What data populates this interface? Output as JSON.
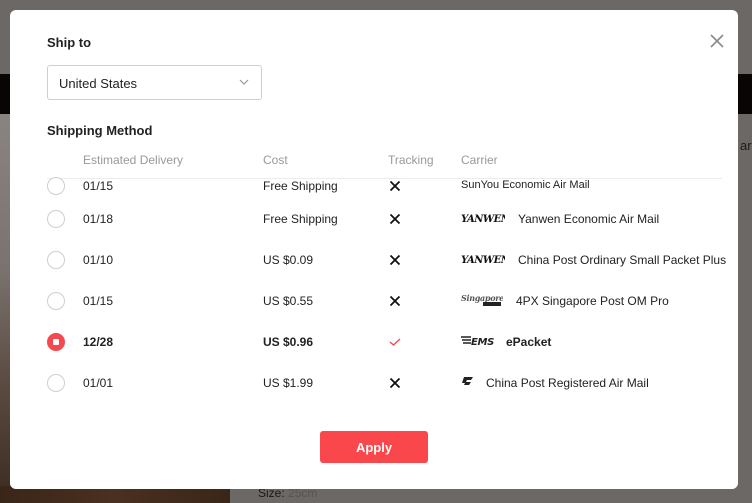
{
  "background": {
    "size_label": "Size:",
    "size_value": "25cm",
    "right_edge_text": "ar"
  },
  "modal": {
    "ship_to_label": "Ship to",
    "country": {
      "selected": "United States"
    },
    "shipping_method_label": "Shipping Method",
    "columns": {
      "delivery": "Estimated Delivery",
      "cost": "Cost",
      "tracking": "Tracking",
      "carrier": "Carrier"
    },
    "rows": [
      {
        "delivery": "01/15",
        "cost": "Free Shipping",
        "tracking": false,
        "carrier_logo": "",
        "carrier": "SunYou Economic Air Mail",
        "selected": false
      },
      {
        "delivery": "01/18",
        "cost": "Free Shipping",
        "tracking": false,
        "carrier_logo": "YANWEN",
        "carrier": "Yanwen Economic Air Mail",
        "selected": false
      },
      {
        "delivery": "01/10",
        "cost": "US $0.09",
        "tracking": false,
        "carrier_logo": "YANWEN",
        "carrier": "China Post Ordinary Small Packet Plus",
        "selected": false
      },
      {
        "delivery": "01/15",
        "cost": "US $0.55",
        "tracking": false,
        "carrier_logo": "Singapore POST",
        "carrier": "4PX Singapore Post OM Pro",
        "selected": false
      },
      {
        "delivery": "12/28",
        "cost": "US $0.96",
        "tracking": true,
        "carrier_logo": "EMS",
        "carrier": "ePacket",
        "selected": true
      },
      {
        "delivery": "01/01",
        "cost": "US $1.99",
        "tracking": false,
        "carrier_logo": "China Post",
        "carrier": "China Post Registered Air Mail",
        "selected": false
      }
    ],
    "apply_label": "Apply",
    "colors": {
      "accent": "#f9474c",
      "radio_checked": "#f5484f",
      "check_icon": "#f5484f"
    }
  }
}
